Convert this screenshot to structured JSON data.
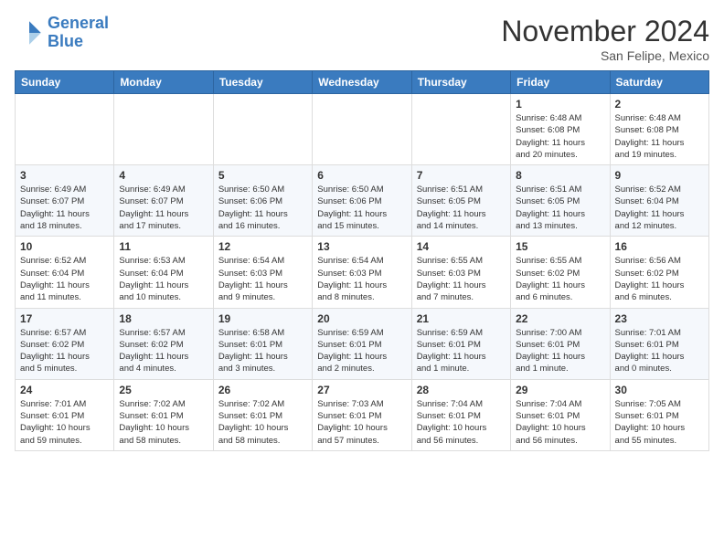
{
  "header": {
    "logo_line1": "General",
    "logo_line2": "Blue",
    "month": "November 2024",
    "location": "San Felipe, Mexico"
  },
  "weekdays": [
    "Sunday",
    "Monday",
    "Tuesday",
    "Wednesday",
    "Thursday",
    "Friday",
    "Saturday"
  ],
  "weeks": [
    [
      {
        "day": "",
        "info": ""
      },
      {
        "day": "",
        "info": ""
      },
      {
        "day": "",
        "info": ""
      },
      {
        "day": "",
        "info": ""
      },
      {
        "day": "",
        "info": ""
      },
      {
        "day": "1",
        "info": "Sunrise: 6:48 AM\nSunset: 6:08 PM\nDaylight: 11 hours\nand 20 minutes."
      },
      {
        "day": "2",
        "info": "Sunrise: 6:48 AM\nSunset: 6:08 PM\nDaylight: 11 hours\nand 19 minutes."
      }
    ],
    [
      {
        "day": "3",
        "info": "Sunrise: 6:49 AM\nSunset: 6:07 PM\nDaylight: 11 hours\nand 18 minutes."
      },
      {
        "day": "4",
        "info": "Sunrise: 6:49 AM\nSunset: 6:07 PM\nDaylight: 11 hours\nand 17 minutes."
      },
      {
        "day": "5",
        "info": "Sunrise: 6:50 AM\nSunset: 6:06 PM\nDaylight: 11 hours\nand 16 minutes."
      },
      {
        "day": "6",
        "info": "Sunrise: 6:50 AM\nSunset: 6:06 PM\nDaylight: 11 hours\nand 15 minutes."
      },
      {
        "day": "7",
        "info": "Sunrise: 6:51 AM\nSunset: 6:05 PM\nDaylight: 11 hours\nand 14 minutes."
      },
      {
        "day": "8",
        "info": "Sunrise: 6:51 AM\nSunset: 6:05 PM\nDaylight: 11 hours\nand 13 minutes."
      },
      {
        "day": "9",
        "info": "Sunrise: 6:52 AM\nSunset: 6:04 PM\nDaylight: 11 hours\nand 12 minutes."
      }
    ],
    [
      {
        "day": "10",
        "info": "Sunrise: 6:52 AM\nSunset: 6:04 PM\nDaylight: 11 hours\nand 11 minutes."
      },
      {
        "day": "11",
        "info": "Sunrise: 6:53 AM\nSunset: 6:04 PM\nDaylight: 11 hours\nand 10 minutes."
      },
      {
        "day": "12",
        "info": "Sunrise: 6:54 AM\nSunset: 6:03 PM\nDaylight: 11 hours\nand 9 minutes."
      },
      {
        "day": "13",
        "info": "Sunrise: 6:54 AM\nSunset: 6:03 PM\nDaylight: 11 hours\nand 8 minutes."
      },
      {
        "day": "14",
        "info": "Sunrise: 6:55 AM\nSunset: 6:03 PM\nDaylight: 11 hours\nand 7 minutes."
      },
      {
        "day": "15",
        "info": "Sunrise: 6:55 AM\nSunset: 6:02 PM\nDaylight: 11 hours\nand 6 minutes."
      },
      {
        "day": "16",
        "info": "Sunrise: 6:56 AM\nSunset: 6:02 PM\nDaylight: 11 hours\nand 6 minutes."
      }
    ],
    [
      {
        "day": "17",
        "info": "Sunrise: 6:57 AM\nSunset: 6:02 PM\nDaylight: 11 hours\nand 5 minutes."
      },
      {
        "day": "18",
        "info": "Sunrise: 6:57 AM\nSunset: 6:02 PM\nDaylight: 11 hours\nand 4 minutes."
      },
      {
        "day": "19",
        "info": "Sunrise: 6:58 AM\nSunset: 6:01 PM\nDaylight: 11 hours\nand 3 minutes."
      },
      {
        "day": "20",
        "info": "Sunrise: 6:59 AM\nSunset: 6:01 PM\nDaylight: 11 hours\nand 2 minutes."
      },
      {
        "day": "21",
        "info": "Sunrise: 6:59 AM\nSunset: 6:01 PM\nDaylight: 11 hours\nand 1 minute."
      },
      {
        "day": "22",
        "info": "Sunrise: 7:00 AM\nSunset: 6:01 PM\nDaylight: 11 hours\nand 1 minute."
      },
      {
        "day": "23",
        "info": "Sunrise: 7:01 AM\nSunset: 6:01 PM\nDaylight: 11 hours\nand 0 minutes."
      }
    ],
    [
      {
        "day": "24",
        "info": "Sunrise: 7:01 AM\nSunset: 6:01 PM\nDaylight: 10 hours\nand 59 minutes."
      },
      {
        "day": "25",
        "info": "Sunrise: 7:02 AM\nSunset: 6:01 PM\nDaylight: 10 hours\nand 58 minutes."
      },
      {
        "day": "26",
        "info": "Sunrise: 7:02 AM\nSunset: 6:01 PM\nDaylight: 10 hours\nand 58 minutes."
      },
      {
        "day": "27",
        "info": "Sunrise: 7:03 AM\nSunset: 6:01 PM\nDaylight: 10 hours\nand 57 minutes."
      },
      {
        "day": "28",
        "info": "Sunrise: 7:04 AM\nSunset: 6:01 PM\nDaylight: 10 hours\nand 56 minutes."
      },
      {
        "day": "29",
        "info": "Sunrise: 7:04 AM\nSunset: 6:01 PM\nDaylight: 10 hours\nand 56 minutes."
      },
      {
        "day": "30",
        "info": "Sunrise: 7:05 AM\nSunset: 6:01 PM\nDaylight: 10 hours\nand 55 minutes."
      }
    ]
  ]
}
